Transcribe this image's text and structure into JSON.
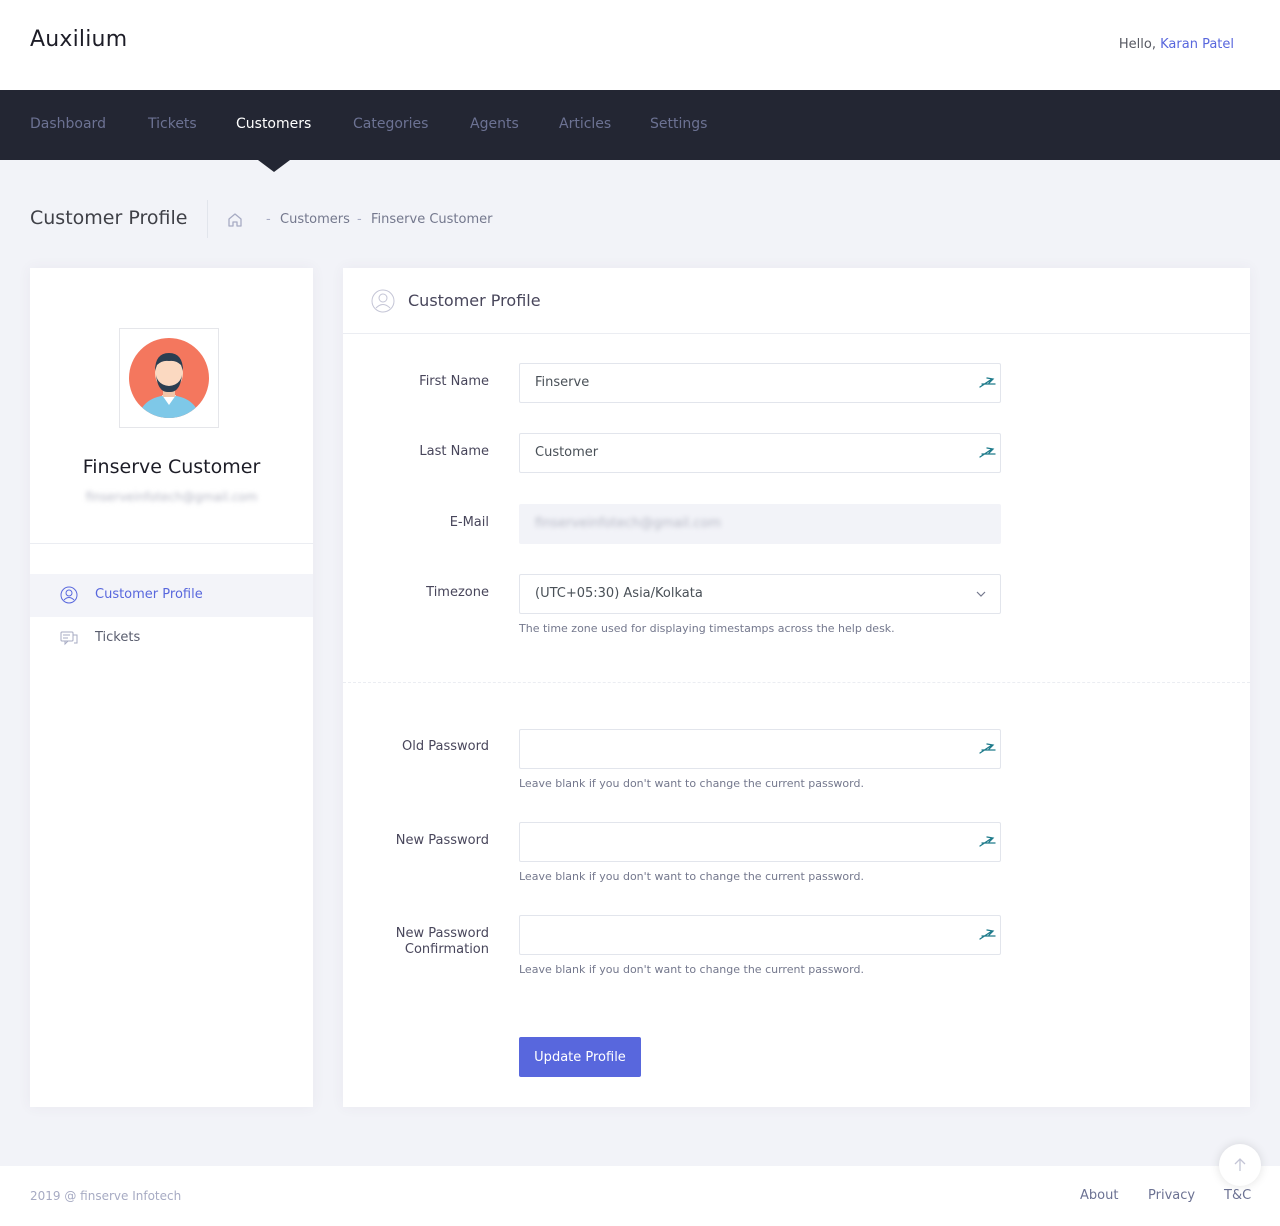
{
  "app": {
    "name": "Auxilium"
  },
  "header": {
    "greeting": "Hello,",
    "user_name": "Karan Patel"
  },
  "nav": {
    "items": [
      {
        "label": "Dashboard",
        "active": false
      },
      {
        "label": "Tickets",
        "active": false
      },
      {
        "label": "Customers",
        "active": true
      },
      {
        "label": "Categories",
        "active": false
      },
      {
        "label": "Agents",
        "active": false
      },
      {
        "label": "Articles",
        "active": false
      },
      {
        "label": "Settings",
        "active": false
      }
    ]
  },
  "subheader": {
    "title": "Customer Profile",
    "breadcrumb": [
      "Customers",
      "Finserve Customer"
    ],
    "separator": "-"
  },
  "profile": {
    "name": "Finserve Customer",
    "email": "finserveinfotech@gmail.com"
  },
  "sidebar": {
    "items": [
      {
        "label": "Customer Profile",
        "icon": "user-circle-icon",
        "active": true
      },
      {
        "label": "Tickets",
        "icon": "chat-icon",
        "active": false
      }
    ]
  },
  "card": {
    "title": "Customer Profile"
  },
  "form": {
    "first_name": {
      "label": "First Name",
      "value": "Finserve"
    },
    "last_name": {
      "label": "Last Name",
      "value": "Customer"
    },
    "email": {
      "label": "E-Mail",
      "value": "finserveinfotech@gmail.com"
    },
    "timezone": {
      "label": "Timezone",
      "value": "(UTC+05:30) Asia/Kolkata",
      "help": "The time zone used for displaying timestamps across the help desk."
    },
    "old_password": {
      "label": "Old Password",
      "value": "",
      "help": "Leave blank if you don't want to change the current password."
    },
    "new_password": {
      "label": "New Password",
      "value": "",
      "help": "Leave blank if you don't want to change the current password."
    },
    "new_password_confirmation": {
      "label_line1": "New Password",
      "label_line2": "Confirmation",
      "value": "",
      "help": "Leave blank if you don't want to change the current password."
    },
    "submit_label": "Update Profile"
  },
  "footer": {
    "copyright": "2019 @ finserve Infotech",
    "links": [
      "About",
      "Privacy",
      "T&C"
    ]
  },
  "colors": {
    "accent": "#5867dd",
    "nav_bg": "#232633",
    "avatar_bg": "#f4775e",
    "addon_icon": "#1d7a8a"
  }
}
